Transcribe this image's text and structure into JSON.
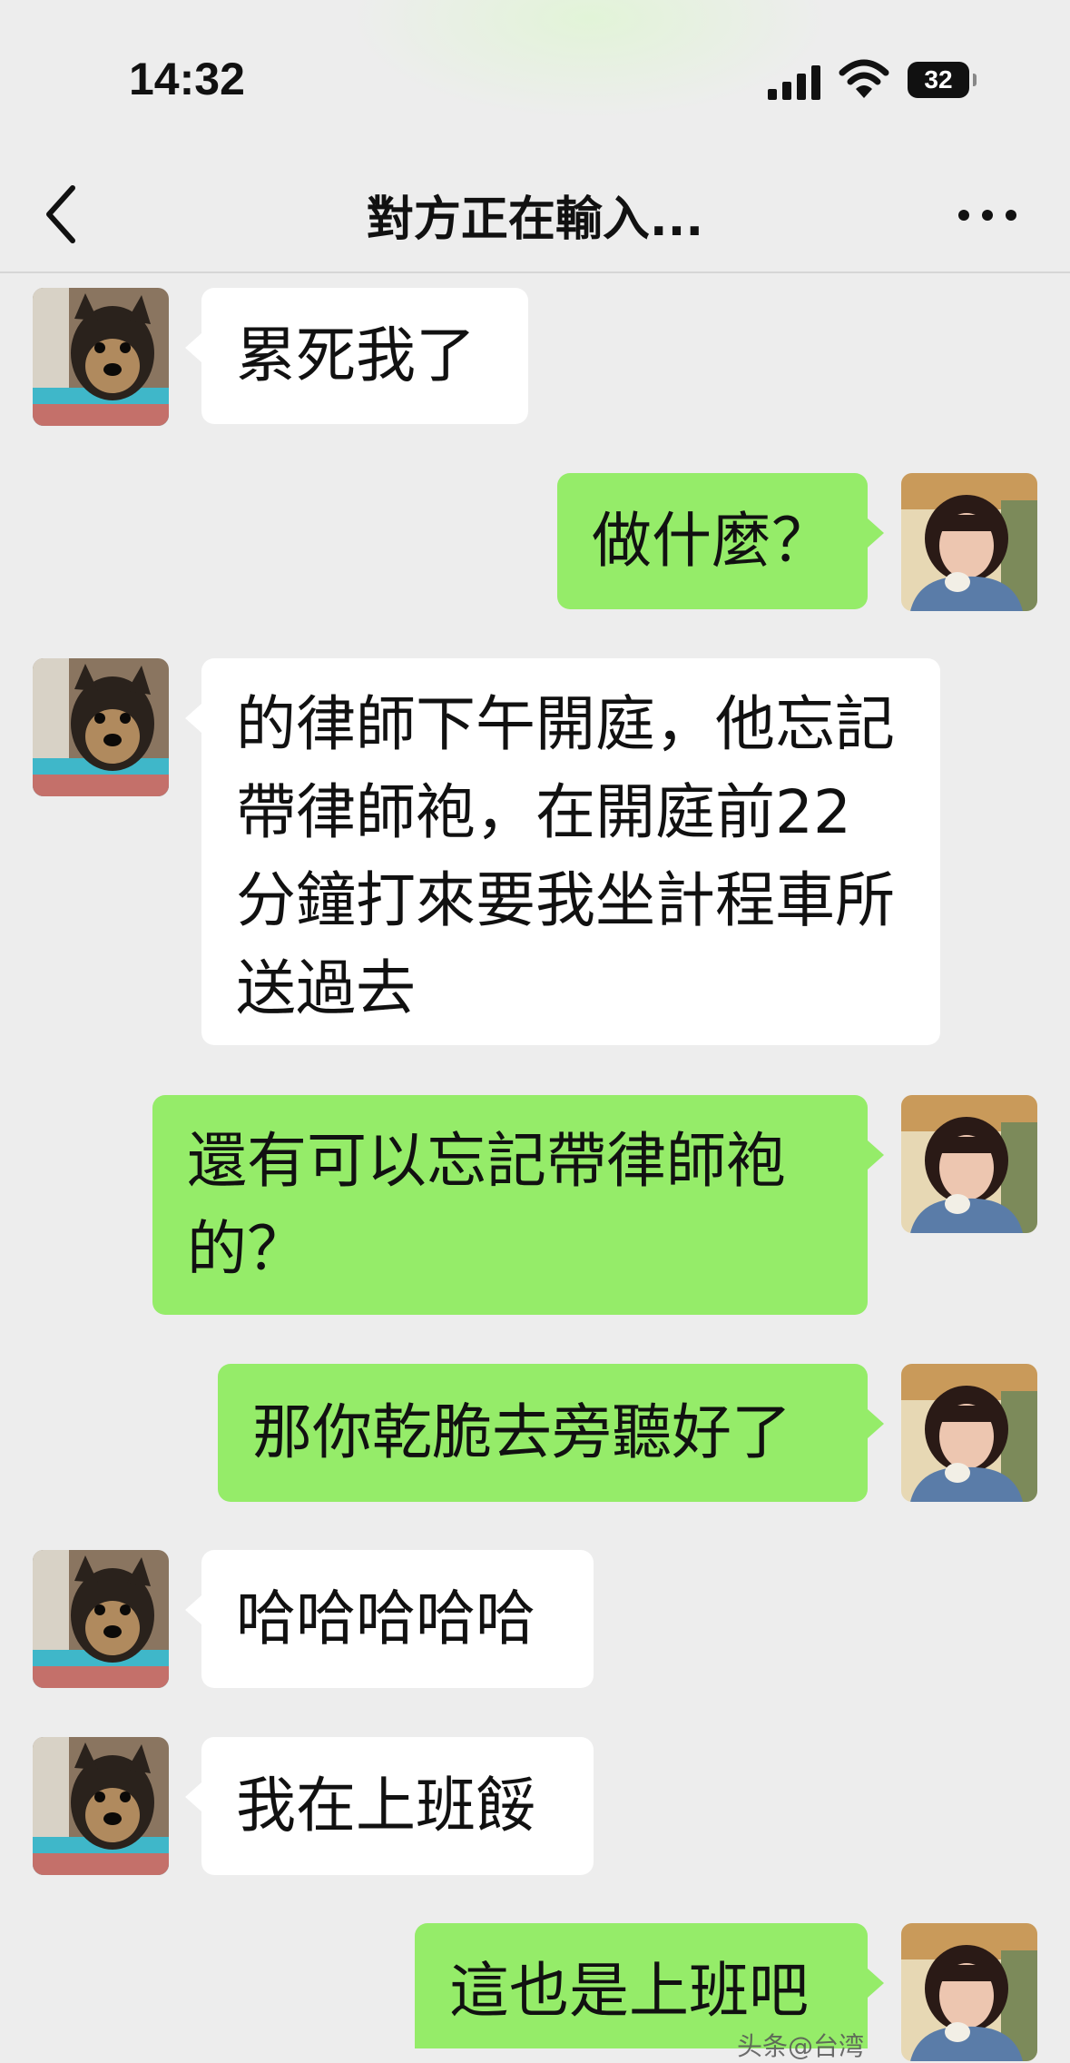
{
  "status_bar": {
    "time": "14:32",
    "battery": "32",
    "icons": [
      "cellular-signal-icon",
      "wifi-icon",
      "battery-icon"
    ]
  },
  "nav": {
    "title": "對方正在輸入...",
    "back_icon": "chevron-left-icon",
    "more_icon": "more-dots-icon"
  },
  "colors": {
    "background": "#ededed",
    "sent_bubble": "#95ec69",
    "received_bubble": "#ffffff"
  },
  "messages": [
    {
      "side": "left",
      "text": "累死我了"
    },
    {
      "side": "right",
      "text": "做什麼？"
    },
    {
      "side": "left",
      "text": "的律師下午開庭，他忘記帶律師袍，在開庭前22 分鐘打來要我坐計程車所送過去"
    },
    {
      "side": "right",
      "text": "還有可以忘記帶律師袍的？"
    },
    {
      "side": "right",
      "text": "那你乾脆去旁聽好了"
    },
    {
      "side": "left",
      "text": "哈哈哈哈哈"
    },
    {
      "side": "left",
      "text": "我在上班餒"
    },
    {
      "side": "right",
      "text": "這也是上班吧"
    }
  ],
  "watermark": "头条@台湾"
}
